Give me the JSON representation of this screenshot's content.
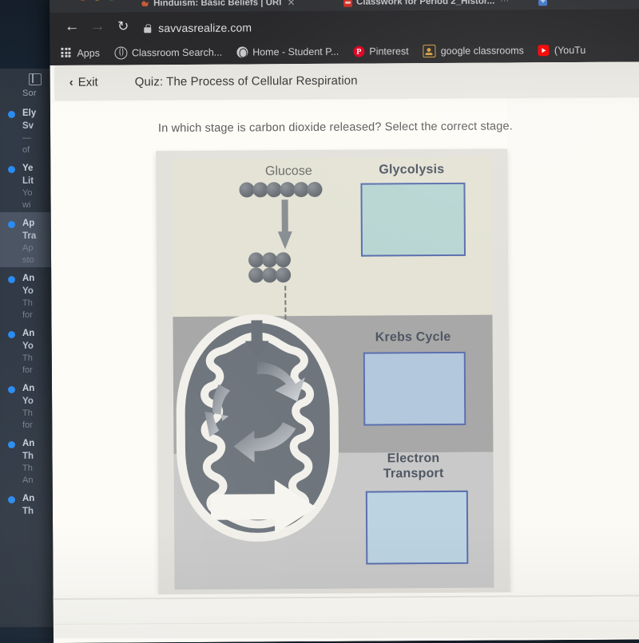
{
  "browser": {
    "tabs": [
      {
        "title": "Hinduism: Basic Beliefs | URI",
        "favicon": "flame-icon",
        "close": "✕"
      },
      {
        "title": "Classwork for Period 2_Histor...",
        "favicon": "youtube-icon",
        "close": "⋯"
      },
      {
        "title": "",
        "favicon": "mail-icon",
        "close": ""
      }
    ],
    "nav": {
      "back": "←",
      "forward": "→",
      "reload": "↻"
    },
    "url": "savvasrealize.com",
    "lock_icon": "lock-icon",
    "bookmarks": [
      {
        "label": "Apps",
        "icon": "apps-grid-icon"
      },
      {
        "label": "Classroom Search...",
        "icon": "globe-icon"
      },
      {
        "label": "Home - Student P...",
        "icon": "globe-filled-icon"
      },
      {
        "label": "Pinterest",
        "icon": "pinterest-icon",
        "glyph": "P"
      },
      {
        "label": "google classrooms",
        "icon": "google-classroom-icon"
      },
      {
        "label": "(YouTu",
        "icon": "youtube-icon"
      }
    ]
  },
  "quiz": {
    "exit_label": "Exit",
    "exit_chevron": "‹",
    "title": "Quiz: The Process of Cellular Respiration",
    "question": "In which stage is carbon dioxide released? Select the correct stage."
  },
  "diagram": {
    "glucose_label": "Glucose",
    "glucose_ball_count": 6,
    "pyruvate_row_count": 3,
    "stages": [
      {
        "label": "Glycolysis",
        "box_fill": "#b9d6d3",
        "box_border": "#5b6fae",
        "band_fill": "#e4e3d5"
      },
      {
        "label": "Krebs Cycle",
        "box_fill": "#b3c8dc",
        "box_border": "#5b6fae",
        "band_fill": "#a8a8a8"
      },
      {
        "label": "Electron\nTransport",
        "box_fill": "#bcd3e2",
        "box_border": "#5b6fae",
        "band_fill": "#c9c9c9"
      }
    ],
    "stage_labels": {
      "glycolysis": "Glycolysis",
      "krebs": "Krebs Cycle",
      "electron_line1": "Electron",
      "electron_line2": "Transport"
    },
    "icons": {
      "down_arrow": "down-arrow-icon",
      "dashed_connector": "dashed-line-icon",
      "mitochondrion": "mitochondrion-icon",
      "cycle_arrows": "circular-arrows-icon",
      "exit_arrow": "block-arrow-icon"
    }
  },
  "background_app": {
    "sort_label": "Sor",
    "items": [
      {
        "line1": "Ely",
        "line2": "Sv",
        "line3": "—",
        "line4": "of",
        "selected": false
      },
      {
        "line1": "Ye",
        "line2": "Lit",
        "line3": "Yo",
        "line4": "wi",
        "selected": false
      },
      {
        "line1": "Ap",
        "line2": "Tra",
        "line3": "Ap",
        "line4": "sto",
        "selected": true
      },
      {
        "line1": "An",
        "line2": "Yo",
        "line3": "Th",
        "line4": "for",
        "selected": false
      },
      {
        "line1": "An",
        "line2": "Yo",
        "line3": "Th",
        "line4": "for",
        "selected": false
      },
      {
        "line1": "An",
        "line2": "Yo",
        "line3": "Th",
        "line4": "for",
        "selected": false
      },
      {
        "line1": "An",
        "line2": "Th",
        "line3": "Th",
        "line4": "An",
        "selected": false
      },
      {
        "line1": "An",
        "line2": "Th",
        "line3": "",
        "line4": "",
        "selected": false
      }
    ]
  },
  "colors": {
    "accent_blue": "#5b6fae",
    "unread_dot": "#2a8cf0",
    "browser_chrome": "#2b2b2d",
    "quiz_bar": "#eceae4"
  }
}
